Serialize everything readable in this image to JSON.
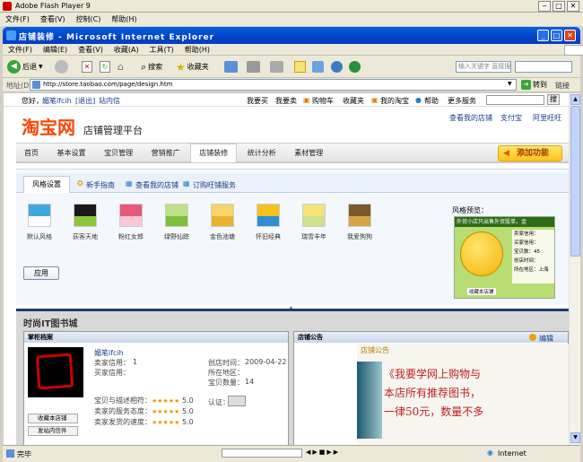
{
  "flash": {
    "title": "Adobe Flash Player 9",
    "menu": [
      "文件(F)",
      "查看(V)",
      "控制(C)",
      "帮助(H)"
    ]
  },
  "ie": {
    "title": "店铺装修 - Microsoft Internet Explorer",
    "menu": [
      "文件(F)",
      "编辑(E)",
      "查看(V)",
      "收藏(A)",
      "工具(T)",
      "帮助(H)"
    ],
    "toolbar": {
      "back": "后退",
      "search": "搜索",
      "favorites": "收藏夹"
    },
    "address_label": "地址(D)",
    "url": "http://store.taobao.com/page/design.htm",
    "search_placeholder": "输入关键字 直接搜索",
    "go": "转到",
    "links": "链接"
  },
  "page": {
    "topbar": {
      "greeting": "您好，",
      "username": "媚笔ifcih",
      "logout": "[退出]",
      "inbox": "站内信",
      "items": [
        "我要买",
        "我要卖",
        "购物车",
        "收藏夹",
        "我的淘宝",
        "帮助",
        "更多服务"
      ],
      "search_btn": "搜"
    },
    "header": {
      "logo": "淘宝网",
      "subtitle": "店铺管理平台",
      "links": [
        "查看我的店铺",
        "支付宝",
        "阿里旺旺"
      ]
    },
    "nav": {
      "tabs": [
        "首页",
        "基本设置",
        "宝贝管理",
        "营销推广",
        "店铺装修",
        "统计分析",
        "素材管理"
      ],
      "add_feature": "添加功能"
    },
    "subtabs": {
      "style": "风格设置",
      "guide": "新手指南",
      "view_shop": "查看我的店铺",
      "wangwang": "订购旺铺服务"
    },
    "styles": [
      {
        "label": "默认风格",
        "top": "#3fa9dd",
        "bottom": "#ffffff"
      },
      {
        "label": "荻客天地",
        "top": "#1a1a1a",
        "bottom": "#8cc63e"
      },
      {
        "label": "粉红女郎",
        "top": "#e8587a",
        "bottom": "#f8c6d4"
      },
      {
        "label": "绿野仙踪",
        "top": "#bfe08a",
        "bottom": "#7cbf3a"
      },
      {
        "label": "金色池塘",
        "top": "#f6d56a",
        "bottom": "#e9b22f"
      },
      {
        "label": "怀旧经典",
        "top": "#f3c21b",
        "bottom": "#2d8fd0"
      },
      {
        "label": "瑞雪丰年",
        "top": "#f5e27a",
        "bottom": "#cfe08f"
      },
      {
        "label": "我爱狗狗",
        "top": "#7a5a2a",
        "bottom": "#d4a44a"
      }
    ],
    "preview": {
      "label": "风格预览：",
      "banner": "外贸小店只出售外贸股单，金",
      "fields": [
        "卖家信用：",
        "买家信用：",
        "宝贝数：45",
        "创店时间：",
        "所在地区：上海"
      ],
      "collect": "收藏本店铺"
    },
    "apply": "应用",
    "shop": {
      "name": "时尚IT图书城",
      "archive_title": "掌柜档案",
      "notice_title": "店铺公告",
      "edit": "编辑",
      "owner": "媚笔ifcih",
      "seller_credit_label": "卖家信用：",
      "seller_credit": "1",
      "buyer_credit_label": "买家信用：",
      "created_label": "创店时间：",
      "created": "2009-04-22",
      "region_label": "所在地区：",
      "count_label": "宝贝数量：",
      "count": "14",
      "ratings": [
        {
          "label": "宝贝与描述相符：",
          "score": "5.0"
        },
        {
          "label": "卖家的服务态度：",
          "score": "5.0"
        },
        {
          "label": "卖家发货的速度：",
          "score": "5.0"
        }
      ],
      "stars": "★★★★★",
      "cert_label": "认证：",
      "collect_btn": "收藏本店铺",
      "msg_btn": "发站内信件",
      "notice_heading": "店铺公告",
      "notice_lines": [
        "《我要学网上购物与",
        "本店所有推荐图书，",
        "一律50元，数量不多"
      ]
    }
  },
  "status": {
    "done": "完毕",
    "zone": "Internet"
  }
}
